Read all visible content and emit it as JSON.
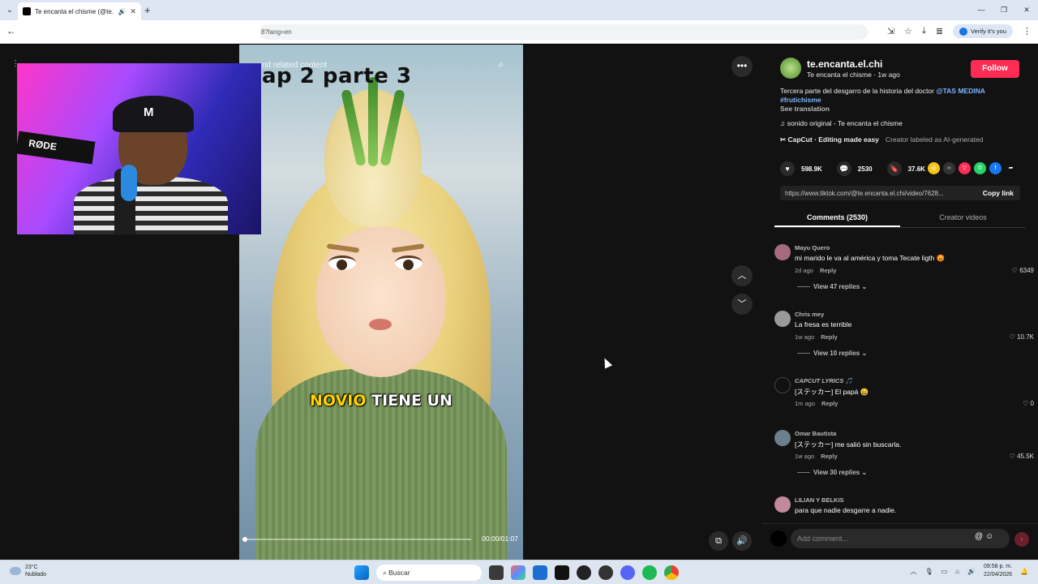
{
  "browser": {
    "tab_title": "Te encanta el chisme (@te.en...",
    "url_visible": "8?lang=en",
    "verify_label": "Verify it's you"
  },
  "video": {
    "title_overlay": "ap 2 parte 3",
    "related_overlay": "nd related content",
    "caption_yellow": "NOVIO",
    "caption_white": "TIENE UN",
    "time": "00:00/01:07",
    "progress": 0
  },
  "webcam": {
    "cap_text": "M",
    "mic_brand": "RØDE"
  },
  "post": {
    "username": "te.encanta.el.chi",
    "subline": "Te encanta el chisme · 1w ago",
    "follow_label": "Follow",
    "description": "Tercera parte del desgarro de la historia del doctor ",
    "mention": "@TAS MEDINA",
    "hashtag": "#frutichisme",
    "see_translation": "See translation",
    "music": "sonido original - Te encanta el chisme",
    "capcut": "CapCut · Editing made easy",
    "ai_label": "Creator labeled as AI-generated",
    "likes": "598.9K",
    "comments_count": "2530",
    "saves": "37.6K",
    "link": "https://www.tiktok.com/@te.encanta.el.chi/video/7628...",
    "copy_label": "Copy link",
    "tab_comments": "Comments (2530)",
    "tab_creator": "Creator videos"
  },
  "comments": [
    {
      "user": "Mayu Quero",
      "text": "mi marido le va al américa y toma Tecate ligth 😡",
      "age": "2d ago",
      "reply": "Reply",
      "likes": "6349",
      "replies": "View 47 replies ⌄",
      "color": "#a56b7c"
    },
    {
      "user": "Chris mey",
      "text": "La fresa es terrible",
      "age": "1w ago",
      "reply": "Reply",
      "likes": "10.7K",
      "replies": "View 10 replies ⌄",
      "color": "#9a9a9a"
    },
    {
      "user": "CAPCUT LYRICS 🎵",
      "text": "[ステッカー] El papá 😄",
      "age": "1m ago",
      "reply": "Reply",
      "likes": "0",
      "replies": "",
      "color": "#111111"
    },
    {
      "user": "Omar Bautista",
      "text": "[ステッカー] me salió sin buscarla.",
      "age": "1w ago",
      "reply": "Reply",
      "likes": "45.5K",
      "replies": "View 30 replies ⌄",
      "color": "#6b7f8c"
    },
    {
      "user": "LILIAN Y BELKIS",
      "text": "para que nadie desgarre a nadie.",
      "age": "",
      "reply": "",
      "likes": "",
      "replies": "",
      "color": "#c08a9a"
    }
  ],
  "add_comment_placeholder": "Add comment...",
  "taskbar": {
    "temp": "23°C",
    "condition": "Nublado",
    "search": "Buscar",
    "time": "09:58 p. m.",
    "date": "22/04/2026"
  },
  "colors": {
    "accent": "#fe2c55",
    "caption_yellow": "#ffd400",
    "link_blue": "#7fb6ff"
  }
}
